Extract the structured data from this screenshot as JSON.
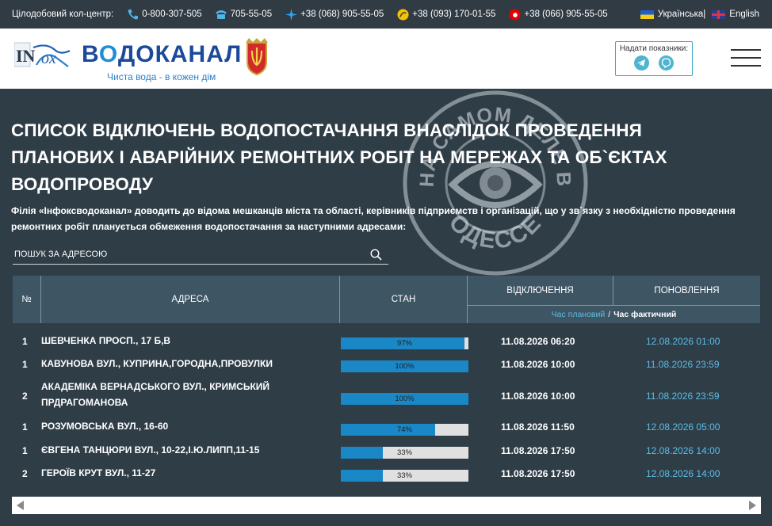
{
  "topbar": {
    "label": "Цілодобовий кол-центр:",
    "phones": [
      {
        "icon": "phone-icon",
        "number": "0-800-307-505"
      },
      {
        "icon": "landline-icon",
        "number": "705-55-05"
      },
      {
        "icon": "kyivstar-icon",
        "number": "+38 (068) 905-55-05"
      },
      {
        "icon": "lifecell-icon",
        "number": "+38 (093) 170-01-55"
      },
      {
        "icon": "vodafone-icon",
        "number": "+38 (066) 905-55-05"
      }
    ],
    "languages": [
      {
        "label": "Українська|",
        "flag": "flag-ua"
      },
      {
        "label": "English",
        "flag": "flag-uk"
      }
    ]
  },
  "header": {
    "logo_text": "ВОДОКАНАЛ",
    "logo_letter_v": "В",
    "logo_letter_o": "О",
    "logo_rest": "ДОКАНАЛ",
    "tagline": "Чиста вода - в кожен дім",
    "readings_label": "Надати показники:",
    "readings_icons": [
      "telegram-icon",
      "viber-icon"
    ]
  },
  "watermark": {
    "top_text": "НА САМОМ ДЕЛЕ В",
    "bottom_text": "ОДЕССЕ"
  },
  "main": {
    "title": "Список відключень водопостачання внаслідок проведення планових і аварійних ремонтних робіт на мережах та об`єктах водопроводу",
    "intro": "Філія «Інфоксводоканал» доводить до відома мешканців міста та області, керівників підприємств і організацій, що у зв`язку з необхідністю проведення ремонтних робіт планується обмеження водопостачання за наступними адресами:",
    "search_placeholder": "ПОШУК ЗА АДРЕСОЮ"
  },
  "table": {
    "headers": {
      "num": "№",
      "address": "АДРЕСА",
      "state": "СТАН",
      "off": "ВІДКЛЮЧЕННЯ",
      "update": "ПОНОВЛЕННЯ",
      "planned": "Час плановий",
      "separator": "/",
      "actual": "Час фактичний"
    },
    "rows": [
      {
        "num": "1",
        "address": "Шевченка просп., 17 Б,В",
        "progress": 97,
        "pct_label": "97%",
        "off": "11.08.2026 06:20",
        "update": "12.08.2026 01:00"
      },
      {
        "num": "1",
        "address": "Кавунова вул., Куприна,Городна,Провулки",
        "progress": 100,
        "pct_label": "100%",
        "off": "11.08.2026 10:00",
        "update": "11.08.2026 23:59"
      },
      {
        "num": "2",
        "address": "Академіка Вернадського вул., Кримський прдрагоманова",
        "progress": 100,
        "pct_label": "100%",
        "off": "11.08.2026 10:00",
        "update": "11.08.2026 23:59"
      },
      {
        "num": "1",
        "address": "Розумовська вул., 16-60",
        "progress": 74,
        "pct_label": "74%",
        "off": "11.08.2026 11:50",
        "update": "12.08.2026 05:00"
      },
      {
        "num": "1",
        "address": "Євгена Танцюри вул., 10-22,І.Ю.Липп,11-15",
        "progress": 33,
        "pct_label": "33%",
        "off": "11.08.2026 17:50",
        "update": "12.08.2026 14:00"
      },
      {
        "num": "2",
        "address": "Героїв Крут вул., 11-27",
        "progress": 33,
        "pct_label": "33%",
        "off": "11.08.2026 17:50",
        "update": "12.08.2026 14:00"
      }
    ]
  },
  "colors": {
    "background": "#2f3d47",
    "table_header": "#3e5564",
    "progress_fill": "#1a87c6",
    "link_blue": "#5cbde6"
  }
}
